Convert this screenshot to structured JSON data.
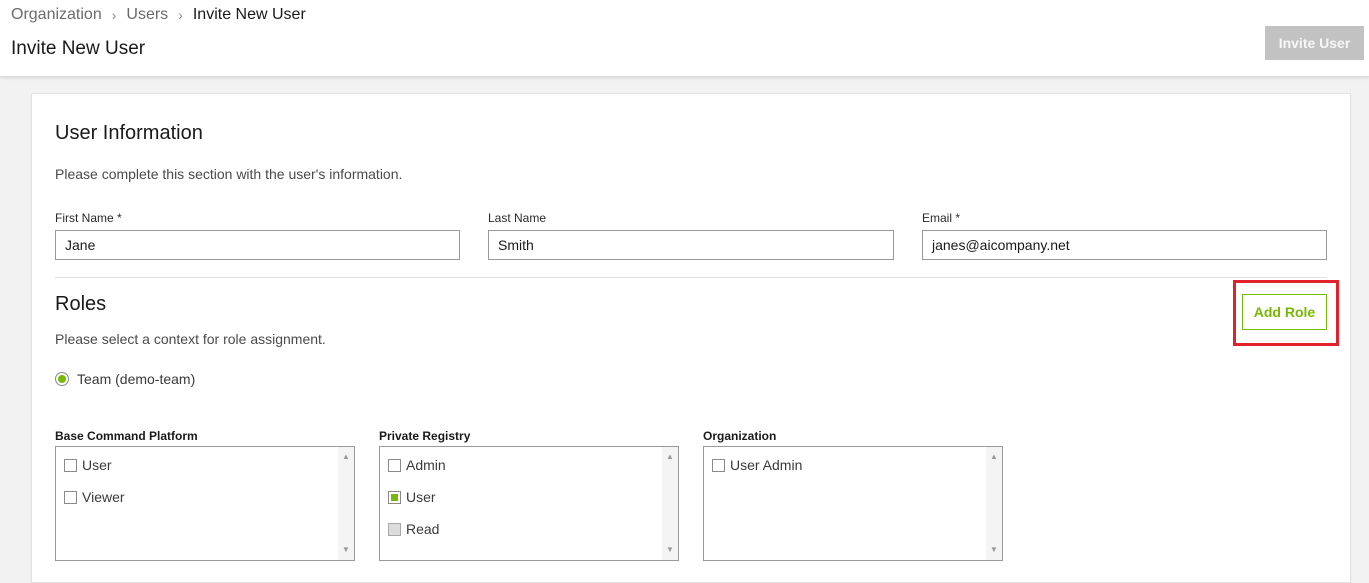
{
  "breadcrumb": {
    "items": [
      "Organization",
      "Users",
      "Invite New User"
    ],
    "separator": "›"
  },
  "header": {
    "title": "Invite New User",
    "invite_button": "Invite User"
  },
  "user_info": {
    "heading": "User Information",
    "description": "Please complete this section with the user's information.",
    "fields": [
      {
        "label": "First Name *",
        "value": "Jane"
      },
      {
        "label": "Last Name",
        "value": "Smith"
      },
      {
        "label": "Email *",
        "value": "janes@aicompany.net"
      }
    ]
  },
  "roles": {
    "heading": "Roles",
    "description": "Please select a context for role assignment.",
    "add_role_button": "Add Role",
    "context_option": "Team (demo-team)",
    "groups": [
      {
        "label": "Base Command Platform",
        "items": [
          {
            "label": "User",
            "state": "unchecked"
          },
          {
            "label": "Viewer",
            "state": "unchecked"
          }
        ]
      },
      {
        "label": "Private Registry",
        "items": [
          {
            "label": "Admin",
            "state": "unchecked"
          },
          {
            "label": "User",
            "state": "checked"
          },
          {
            "label": "Read",
            "state": "disabled"
          }
        ]
      },
      {
        "label": "Organization",
        "items": [
          {
            "label": "User Admin",
            "state": "unchecked"
          }
        ]
      }
    ]
  },
  "colors": {
    "accent": "#76b900",
    "highlight": "#e3212b",
    "disabled_button": "#c2c2c2"
  }
}
